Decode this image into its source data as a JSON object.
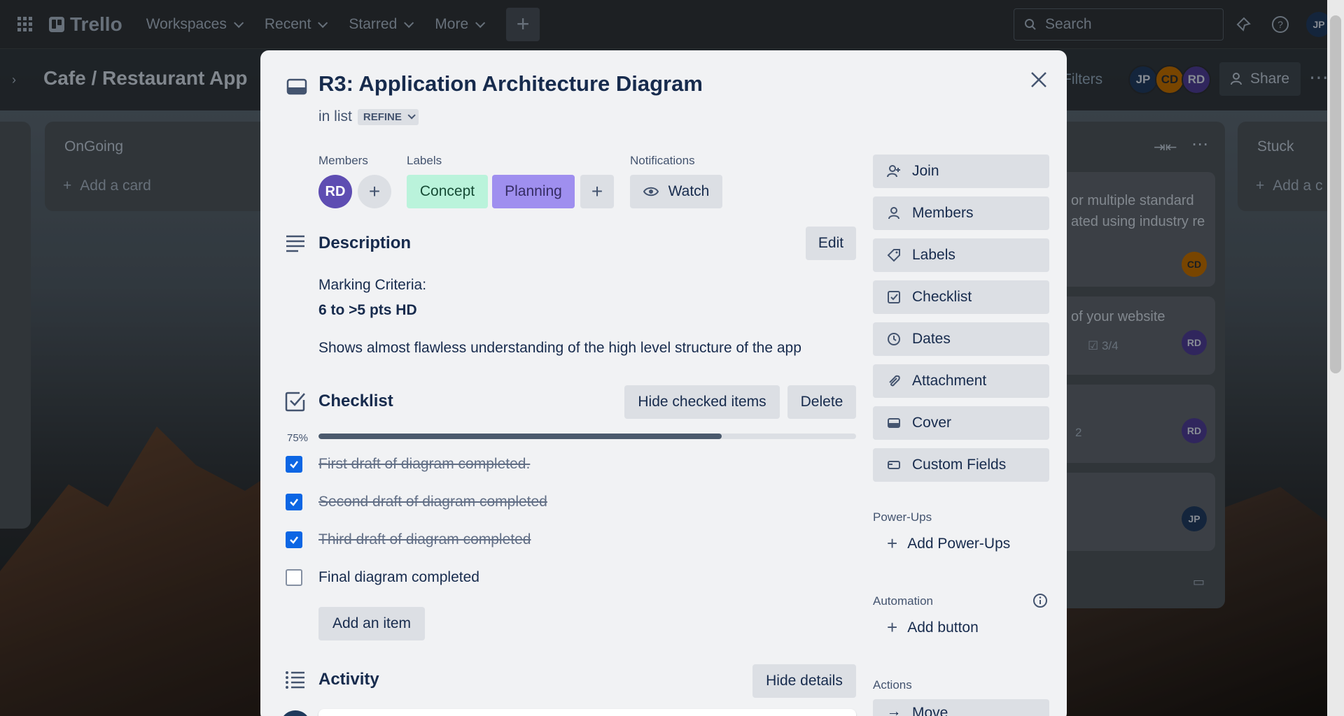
{
  "topnav": {
    "app_name": "Trello",
    "items": [
      {
        "label": "Workspaces"
      },
      {
        "label": "Recent"
      },
      {
        "label": "Starred"
      },
      {
        "label": "More"
      }
    ],
    "search_placeholder": "Search",
    "avatar_initials": "JP"
  },
  "board": {
    "title": "Cafe / Restaurant App",
    "filters_label": "Filters",
    "members": [
      {
        "initials": "JP",
        "color": "#1f3a5c"
      },
      {
        "initials": "CD",
        "color": "#b86b00"
      },
      {
        "initials": "RD",
        "color": "#4b3b8f"
      }
    ],
    "share_label": "Share",
    "lists": [
      {
        "title": "OnGoing",
        "add_label": "Add a card"
      },
      {
        "title": "Stuck",
        "add_label": "Add a c"
      }
    ],
    "bg_cards": [
      {
        "text": "or multiple standard ated using industry re",
        "avatar": "CD"
      },
      {
        "text": "of your website",
        "checklist": "3/4",
        "avatar": "RD"
      },
      {
        "text": "2",
        "avatar": "RD"
      },
      {
        "text": "",
        "avatar": "JP"
      }
    ]
  },
  "card": {
    "title": "R3: Application Architecture Diagram",
    "in_list_prefix": "in list",
    "list_name": "REFINE",
    "members_label": "Members",
    "member_initials": "RD",
    "labels_label": "Labels",
    "labels": [
      {
        "name": "Concept",
        "color": "#baf3db"
      },
      {
        "name": "Planning",
        "color": "#9f8fef"
      }
    ],
    "notifications_label": "Notifications",
    "watch_label": "Watch",
    "description": {
      "title": "Description",
      "edit_label": "Edit",
      "line1": "Marking Criteria:",
      "line2": "6 to >5 pts HD",
      "line3": "Shows almost flawless understanding of the high level structure of the app"
    },
    "checklist": {
      "title": "Checklist",
      "hide_checked_label": "Hide checked items",
      "delete_label": "Delete",
      "progress_text": "75%",
      "progress": 0.75,
      "items": [
        {
          "text": "First draft of diagram completed.",
          "checked": true
        },
        {
          "text": "Second draft of diagram completed",
          "checked": true
        },
        {
          "text": "Third draft of diagram completed",
          "checked": true
        },
        {
          "text": "Final diagram completed",
          "checked": false
        }
      ],
      "add_item_label": "Add an item"
    },
    "activity": {
      "title": "Activity",
      "hide_details_label": "Hide details"
    }
  },
  "sidebar": {
    "add_to_card": [
      {
        "label": "Join",
        "icon": "person-add-icon"
      },
      {
        "label": "Members",
        "icon": "person-icon"
      },
      {
        "label": "Labels",
        "icon": "tag-icon"
      },
      {
        "label": "Checklist",
        "icon": "checkbox-icon"
      },
      {
        "label": "Dates",
        "icon": "clock-icon"
      },
      {
        "label": "Attachment",
        "icon": "paperclip-icon"
      },
      {
        "label": "Cover",
        "icon": "cover-icon"
      },
      {
        "label": "Custom Fields",
        "icon": "custom-fields-icon"
      }
    ],
    "powerups_heading": "Power-Ups",
    "add_powerups_label": "Add Power-Ups",
    "automation_heading": "Automation",
    "add_button_label": "Add button",
    "actions_heading": "Actions",
    "move_label": "Move"
  }
}
